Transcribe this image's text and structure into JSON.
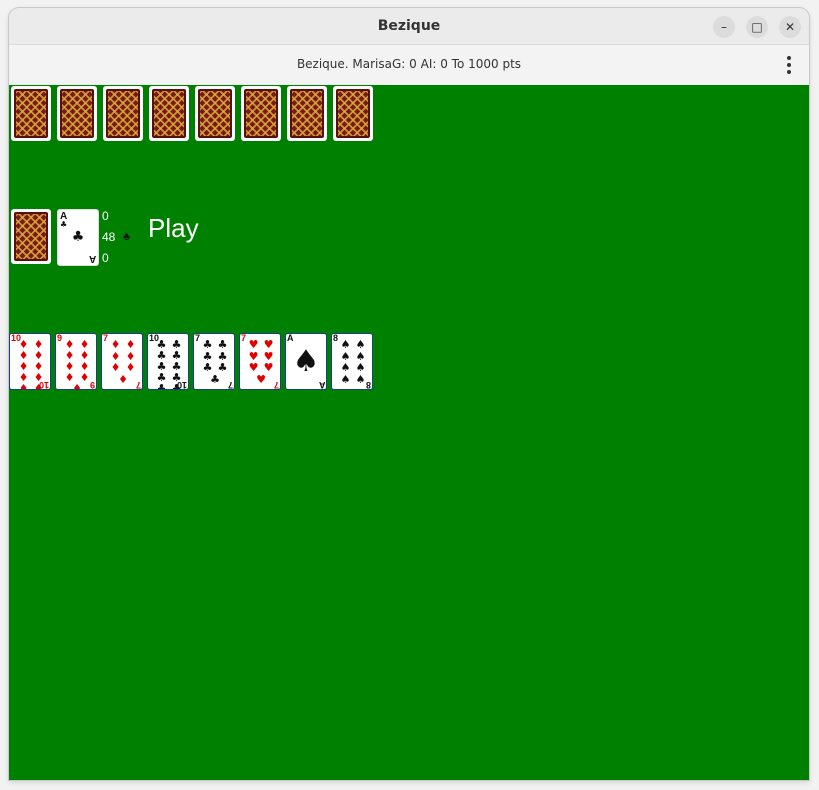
{
  "window": {
    "title": "Bezique",
    "minimize_label": "–",
    "maximize_label": "□",
    "close_label": "✕"
  },
  "status": {
    "text": "Bezique. MarisaG: 0  AI: 0  To 1000 pts"
  },
  "opponent": {
    "hidden_cards": 8
  },
  "stock": {
    "trump_card": {
      "rank": "A",
      "suit": "♣",
      "color": "#111111"
    },
    "score_top": "0",
    "cards_left": "48",
    "trump_suit_symbol": "♣",
    "score_bottom": "0"
  },
  "action": {
    "label": "Play"
  },
  "hand": [
    {
      "rank": "10",
      "suit": "♦",
      "color": "red"
    },
    {
      "rank": "9",
      "suit": "♦",
      "color": "red"
    },
    {
      "rank": "7",
      "suit": "♦",
      "color": "red"
    },
    {
      "rank": "10",
      "suit": "♣",
      "color": "black"
    },
    {
      "rank": "7",
      "suit": "♣",
      "color": "black"
    },
    {
      "rank": "7",
      "suit": "♥",
      "color": "red"
    },
    {
      "rank": "A",
      "suit": "♠",
      "color": "black"
    },
    {
      "rank": "8",
      "suit": "♠",
      "color": "black"
    }
  ],
  "colors": {
    "table": "#008000",
    "card_border": "#1b3f8b",
    "card_back": "#7d1818"
  }
}
